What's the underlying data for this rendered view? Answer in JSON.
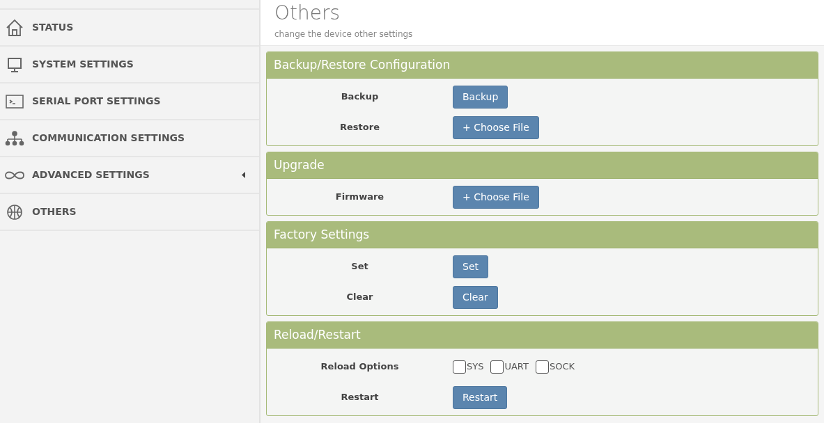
{
  "sidebar": {
    "items": [
      {
        "label": "STATUS",
        "submenu": false
      },
      {
        "label": "SYSTEM SETTINGS",
        "submenu": false
      },
      {
        "label": "SERIAL PORT SETTINGS",
        "submenu": false
      },
      {
        "label": "COMMUNICATION SETTINGS",
        "submenu": false
      },
      {
        "label": "ADVANCED SETTINGS",
        "submenu": true
      },
      {
        "label": "OTHERS",
        "submenu": false
      }
    ]
  },
  "header": {
    "title": "Others",
    "subtitle": "change the device other settings"
  },
  "panels": [
    {
      "title": "Backup/Restore Configuration",
      "rows": [
        {
          "label": "Backup",
          "kind": "button",
          "button": "Backup"
        },
        {
          "label": "Restore",
          "kind": "file",
          "button": "+ Choose File"
        }
      ]
    },
    {
      "title": "Upgrade",
      "rows": [
        {
          "label": "Firmware",
          "kind": "file",
          "button": "+ Choose File"
        }
      ]
    },
    {
      "title": "Factory Settings",
      "rows": [
        {
          "label": "Set",
          "kind": "button",
          "button": "Set"
        },
        {
          "label": "Clear",
          "kind": "button",
          "button": "Clear"
        }
      ]
    },
    {
      "title": "Reload/Restart",
      "rows": [
        {
          "label": "Reload Options",
          "kind": "checkboxes",
          "options": [
            {
              "label": "SYS",
              "checked": false
            },
            {
              "label": "UART",
              "checked": false
            },
            {
              "label": "SOCK",
              "checked": false
            }
          ]
        },
        {
          "label": "Restart",
          "kind": "button",
          "button": "Restart"
        }
      ]
    }
  ]
}
